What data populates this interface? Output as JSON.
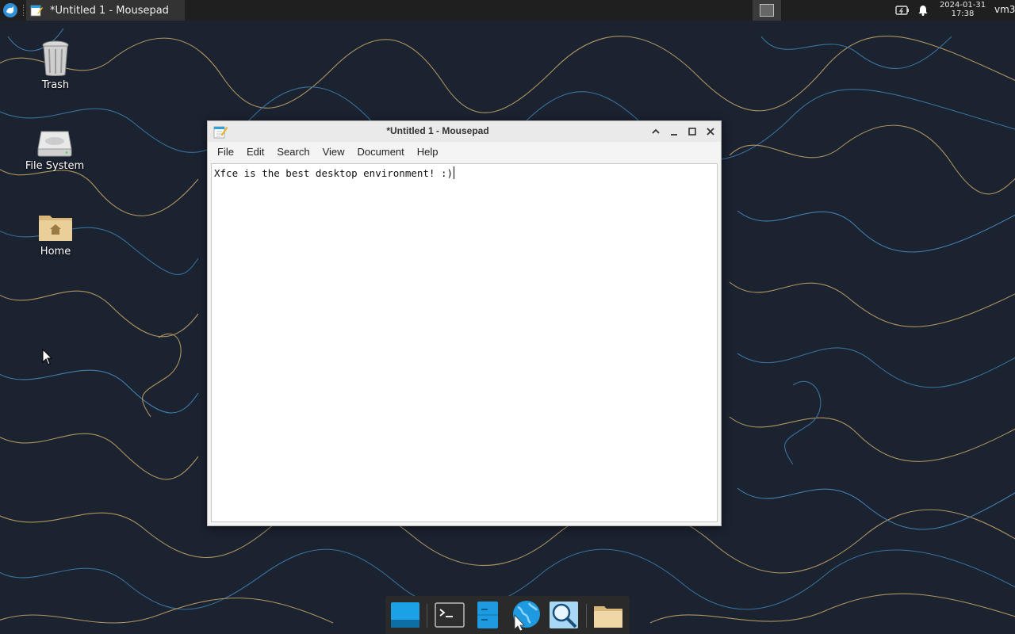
{
  "panel": {
    "active_window_title": "*Untitled 1 - Mousepad",
    "clock_date": "2024-01-31",
    "clock_time": "17:38",
    "user_label": "vm3"
  },
  "desktop": {
    "icons": [
      {
        "label": "Trash",
        "icon": "trash-icon"
      },
      {
        "label": "File System",
        "icon": "drive-icon"
      },
      {
        "label": "Home",
        "icon": "home-folder-icon"
      }
    ]
  },
  "window": {
    "title": "*Untitled 1 - Mousepad",
    "menu": [
      "File",
      "Edit",
      "Search",
      "View",
      "Document",
      "Help"
    ],
    "content": "Xfce is the best desktop environment! :)"
  },
  "dock": {
    "items": [
      "show-desktop-icon",
      "terminal-icon",
      "file-manager-icon",
      "web-browser-icon",
      "app-finder-icon",
      "folder-icon"
    ]
  },
  "colors": {
    "wallpaper": "#1b2230",
    "panel": "#1f1f1f",
    "accent": "#1aa1e6"
  }
}
